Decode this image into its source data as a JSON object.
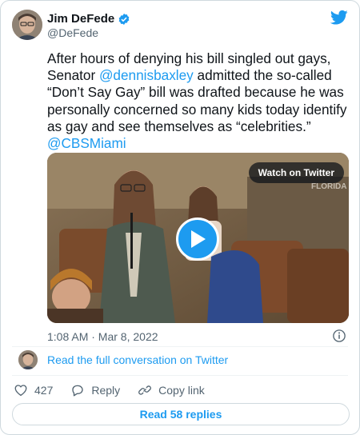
{
  "author": {
    "name": "Jim DeFede",
    "handle": "@DeFede"
  },
  "tweet": {
    "segments": [
      {
        "text": "After hours of denying his bill singled out gays, Senator ",
        "link": false
      },
      {
        "text": "@dennisbaxley",
        "link": true
      },
      {
        "text": " admitted the so-called “Don’t Say Gay” bill was drafted because he was personally concerned so many kids today identify as gay and see themselves as “celebrities.” ",
        "link": false
      },
      {
        "text": "@CBSMiami",
        "link": true
      }
    ],
    "timestamp": "1:08 AM · Mar 8, 2022"
  },
  "media": {
    "watch_label": "Watch on Twitter"
  },
  "conversation": {
    "label": "Read the full conversation on Twitter"
  },
  "actions": {
    "like_count": "427",
    "reply_label": "Reply",
    "copy_label": "Copy link"
  },
  "replies_button": {
    "label": "Read 58 replies"
  },
  "colors": {
    "accent": "#1d9bf0",
    "text": "#0f1419",
    "secondary": "#536471",
    "border": "#cfd9de"
  },
  "icons": [
    "verified-badge-icon",
    "twitter-bird-icon",
    "play-icon",
    "info-icon",
    "heart-icon",
    "reply-icon",
    "link-icon"
  ]
}
